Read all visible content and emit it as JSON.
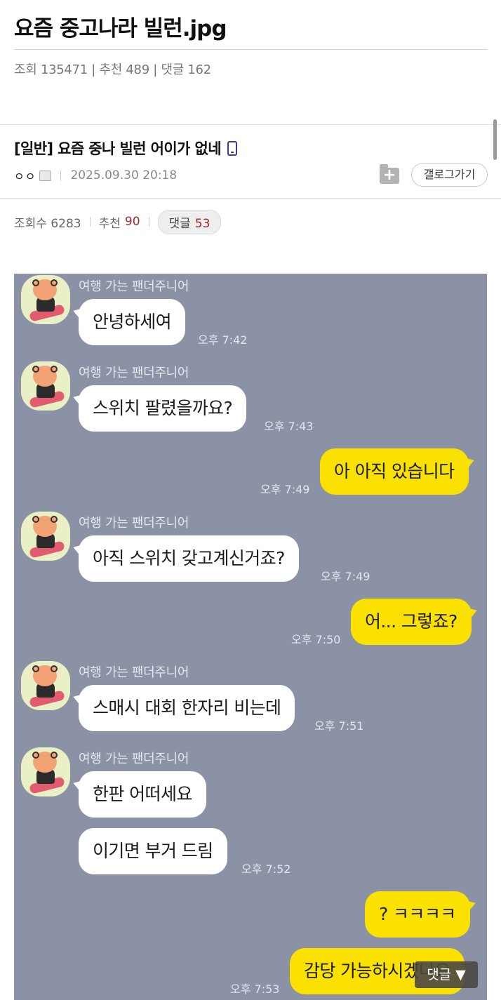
{
  "post": {
    "title": "요즘 중고나라 빌런.jpg",
    "stats": "조회 135471 | 추천 489 | 댓글 162"
  },
  "inner_post": {
    "title": "[일반] 요즘 중나 빌런 어이가 없네",
    "author": "ㅇㅇ",
    "date": "2025.09.30 20:18",
    "gallery_button": "갤로그가기",
    "views": "조회수 6283",
    "recommend_label": "추천",
    "recommend_count": "90",
    "comment_label": "댓글",
    "comment_count": "53"
  },
  "chat": {
    "sender_name": "여행 가는 팬더주니어",
    "messages": [
      {
        "side": "in",
        "text": "안녕하세여",
        "time": "오후 7:42"
      },
      {
        "side": "in",
        "text": "스위치 팔렸을까요?",
        "time": "오후 7:43"
      },
      {
        "side": "out",
        "text": "아 아직 있습니다",
        "time": "오후 7:49"
      },
      {
        "side": "in",
        "text": "아직 스위치 갖고계신거죠?",
        "time": "오후 7:49"
      },
      {
        "side": "out",
        "text": "어... 그렇죠?",
        "time": "오후 7:50"
      },
      {
        "side": "in",
        "text": "스매시 대회 한자리 비는데",
        "time": "오후 7:51"
      },
      {
        "side": "in",
        "text": "한판 어떠세요",
        "time": ""
      },
      {
        "side": "in",
        "text": "이기면 부거 드림",
        "time": "오후 7:52"
      },
      {
        "side": "out",
        "text": "? ㅋㅋㅋㅋ",
        "time": ""
      },
      {
        "side": "out",
        "text": "감당 가능하시겠나요",
        "time": "오후 7:53"
      }
    ]
  },
  "floating_comment_button": "댓글 ▼",
  "colors": {
    "chat_background": "#8b92a6",
    "incoming_bubble": "#ffffff",
    "outgoing_bubble": "#fae100",
    "count_highlight": "#9c2b2b"
  },
  "icons": [
    "phone-icon",
    "scrap-add-icon",
    "avatar-panda-skateboard"
  ]
}
